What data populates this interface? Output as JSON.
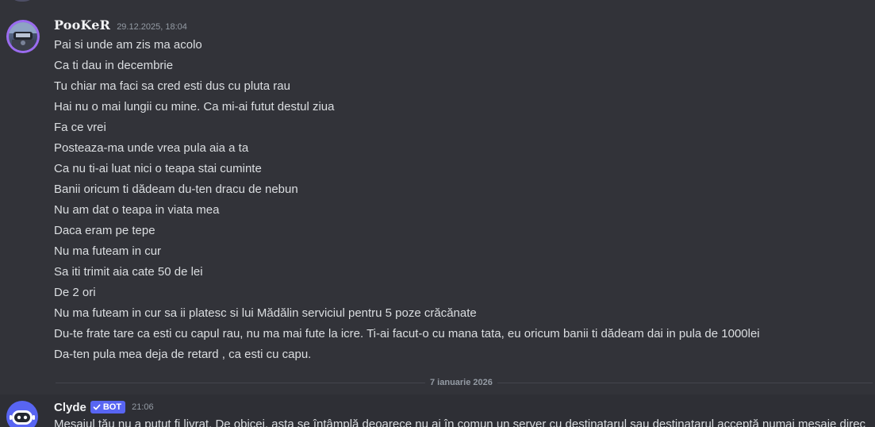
{
  "message": {
    "username": "PooKeR",
    "timestamp": "29.12.2025, 18:04",
    "lines": [
      "Pai si unde am zis ma acolo",
      "Ca ti dau in decembrie",
      "Tu chiar ma faci sa cred esti dus cu pluta rau",
      "Hai nu o mai lungii cu mine. Ca mi-ai futut destul ziua",
      "Fa ce vrei",
      "Posteaza-ma unde vrea pula aia a ta",
      "Ca nu ti-ai luat nici o teapa stai cuminte",
      "Banii oricum ti dădeam du-ten dracu de nebun",
      "Nu am dat o teapa in viata mea",
      "Daca eram pe tepe",
      "Nu ma futeam in cur",
      "Sa iti trimit aia cate 50 de lei",
      "De 2 ori",
      "Nu ma futeam in cur sa ii platesc si lui Mădălin serviciul pentru 5 poze crăcănate",
      "Du-te frate tare ca esti cu capul rau, nu ma mai fute la icre. Ti-ai facut-o cu mana tata, eu oricum banii ti dădeam dai in pula de 1000lei",
      "Da-ten pula mea deja de retard , ca esti cu capu."
    ]
  },
  "date_divider": "7 ianuarie 2026",
  "bot_message": {
    "username": "Clyde",
    "badge": "BOT",
    "timestamp": "21:06",
    "text": "Mesajul tău nu a putut fi livrat. De obicei, asta se întâmplă deoarece nu ai în comun un server cu destinatarul sau destinatarul acceptă numai mesaje direc"
  },
  "colors": {
    "background": "#323339",
    "accent": "#5865f2",
    "avatar_ring": "#9b6cf0"
  }
}
